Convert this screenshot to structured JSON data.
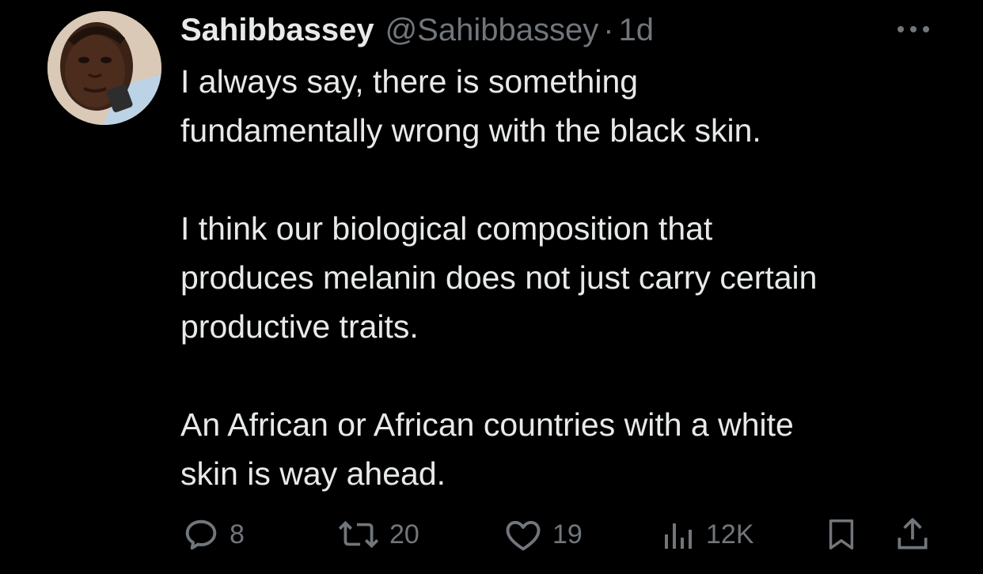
{
  "tweet": {
    "display_name": "Sahibbassey",
    "handle": "@Sahibbassey",
    "separator": "·",
    "time": "1d",
    "paragraphs": [
      "I always say, there is something\nfundamentally wrong with the black skin.",
      "I think our biological composition that\nproduces melanin does not just carry certain\nproductive traits.",
      "An African or African countries with a white\nskin is way ahead."
    ]
  },
  "actions": {
    "reply": {
      "icon": "reply-icon",
      "count": "8"
    },
    "retweet": {
      "icon": "retweet-icon",
      "count": "20"
    },
    "like": {
      "icon": "heart-icon",
      "count": "19"
    },
    "views": {
      "icon": "views-chart-icon",
      "count": "12K"
    },
    "bookmark": {
      "icon": "bookmark-icon"
    },
    "share": {
      "icon": "share-icon"
    }
  },
  "colors": {
    "background": "#000000",
    "primary_text": "#e7e9ea",
    "secondary_text": "#71767b"
  }
}
